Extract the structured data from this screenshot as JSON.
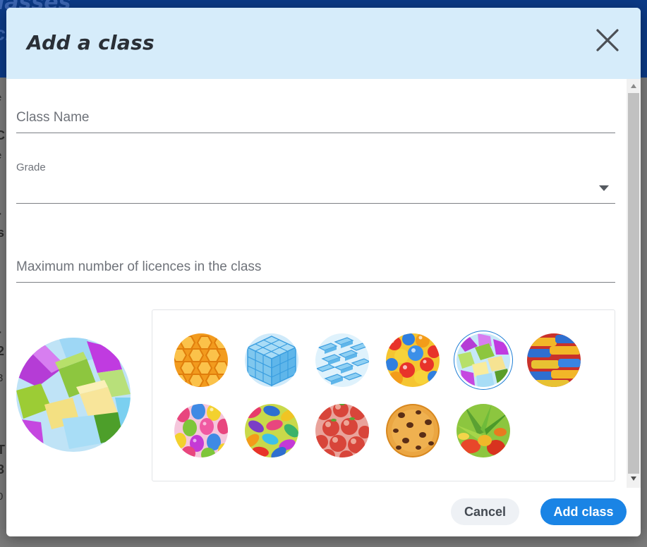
{
  "background": {
    "header_title": "lasses",
    "header_sub": "cl",
    "glyphs": [
      "e",
      "C",
      "e",
      "-",
      "s",
      "I",
      "-",
      "2",
      "3",
      "T",
      "3",
      "0"
    ]
  },
  "modal": {
    "title": "Add a class",
    "close_icon": "close-icon",
    "fields": {
      "class_name": {
        "placeholder": "Class Name",
        "value": ""
      },
      "grade": {
        "label": "Grade",
        "value": ""
      },
      "max_licences": {
        "placeholder": "Maximum number of licences in the class",
        "value": ""
      }
    },
    "avatar_picker": {
      "selected": "cubes",
      "options": [
        "honeycomb",
        "blue-cube-grid",
        "ice-blocks",
        "gumballs",
        "cubes",
        "coins",
        "balloons",
        "jelly-beans",
        "apples",
        "cookie",
        "vegetables"
      ]
    },
    "buttons": {
      "cancel": "Cancel",
      "add": "Add class"
    }
  },
  "colors": {
    "header_bg": "#d6ecfa",
    "primary": "#1a84e5",
    "selected_ring": "#1f7fd6"
  }
}
